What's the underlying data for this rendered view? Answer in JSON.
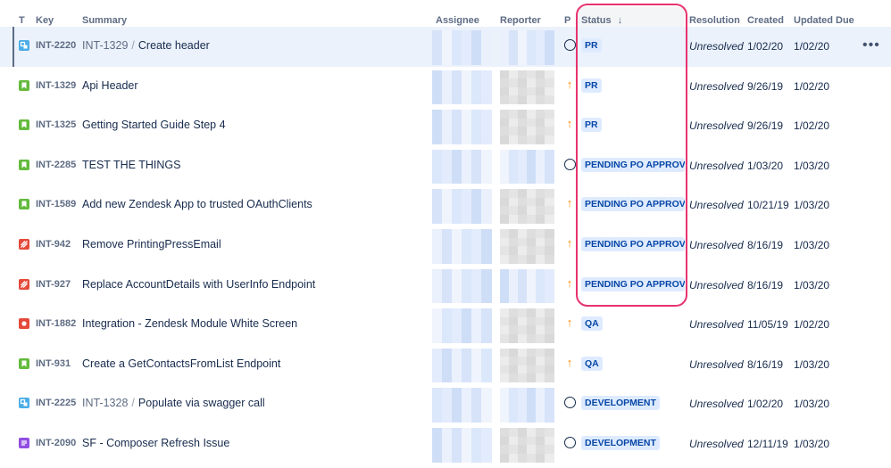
{
  "columns": {
    "type": "T",
    "key": "Key",
    "summary": "Summary",
    "assignee": "Assignee",
    "reporter": "Reporter",
    "priority": "P",
    "status": "Status",
    "status_sort_icon": "↓",
    "resolution": "Resolution",
    "created": "Created",
    "updated": "Updated",
    "due": "Due"
  },
  "colors": {
    "subtask": "#4bade8",
    "story": "#63ba3c",
    "bug": "#e5493a",
    "improvement": "#e5493a",
    "epic": "#904ee2",
    "highlight": "#e8336e",
    "status_bg": "#deebff",
    "status_fg": "#0747a6",
    "priority_up": "#ff8b00"
  },
  "more_icon": "•••",
  "rows": [
    {
      "type": "subtask",
      "key": "INT-2220",
      "parent": "INT-1329",
      "summary": "Create header",
      "priority": "circle",
      "status": "PR",
      "resolution": "Unresolved",
      "created": "1/02/20",
      "updated": "1/02/20",
      "selected": true
    },
    {
      "type": "story",
      "key": "INT-1329",
      "parent": "",
      "summary": "Api Header",
      "priority": "up",
      "status": "PR",
      "resolution": "Unresolved",
      "created": "9/26/19",
      "updated": "1/02/20"
    },
    {
      "type": "story",
      "key": "INT-1325",
      "parent": "",
      "summary": "Getting Started Guide Step 4",
      "priority": "up",
      "status": "PR",
      "resolution": "Unresolved",
      "created": "9/26/19",
      "updated": "1/02/20"
    },
    {
      "type": "story",
      "key": "INT-2285",
      "parent": "",
      "summary": "TEST THE THINGS",
      "priority": "circle",
      "status": "PENDING PO APPROVAL",
      "resolution": "Unresolved",
      "created": "1/03/20",
      "updated": "1/03/20"
    },
    {
      "type": "story",
      "key": "INT-1589",
      "parent": "",
      "summary": "Add new Zendesk App to trusted OAuthClients",
      "priority": "up",
      "status": "PENDING PO APPROVAL",
      "resolution": "Unresolved",
      "created": "10/21/19",
      "updated": "1/03/20"
    },
    {
      "type": "improvement",
      "key": "INT-942",
      "parent": "",
      "summary": "Remove PrintingPressEmail",
      "priority": "up",
      "status": "PENDING PO APPROVAL",
      "resolution": "Unresolved",
      "created": "8/16/19",
      "updated": "1/03/20"
    },
    {
      "type": "improvement",
      "key": "INT-927",
      "parent": "",
      "summary": "Replace AccountDetails with UserInfo Endpoint",
      "priority": "up",
      "status": "PENDING PO APPROVAL",
      "resolution": "Unresolved",
      "created": "8/16/19",
      "updated": "1/03/20"
    },
    {
      "type": "bug",
      "key": "INT-1882",
      "parent": "",
      "summary": "Integration - Zendesk Module White Screen",
      "priority": "up",
      "status": "QA",
      "resolution": "Unresolved",
      "created": "11/05/19",
      "updated": "1/02/20"
    },
    {
      "type": "story",
      "key": "INT-931",
      "parent": "",
      "summary": "Create a GetContactsFromList Endpoint",
      "priority": "up",
      "status": "QA",
      "resolution": "Unresolved",
      "created": "8/16/19",
      "updated": "1/03/20"
    },
    {
      "type": "subtask",
      "key": "INT-2225",
      "parent": "INT-1328",
      "summary": "Populate via swagger call",
      "priority": "circle",
      "status": "DEVELOPMENT",
      "resolution": "Unresolved",
      "created": "1/02/20",
      "updated": "1/03/20"
    },
    {
      "type": "epic",
      "key": "INT-2090",
      "parent": "",
      "summary": "SF - Composer Refresh Issue",
      "priority": "circle",
      "status": "DEVELOPMENT",
      "resolution": "Unresolved",
      "created": "12/11/19",
      "updated": "1/03/20"
    }
  ]
}
